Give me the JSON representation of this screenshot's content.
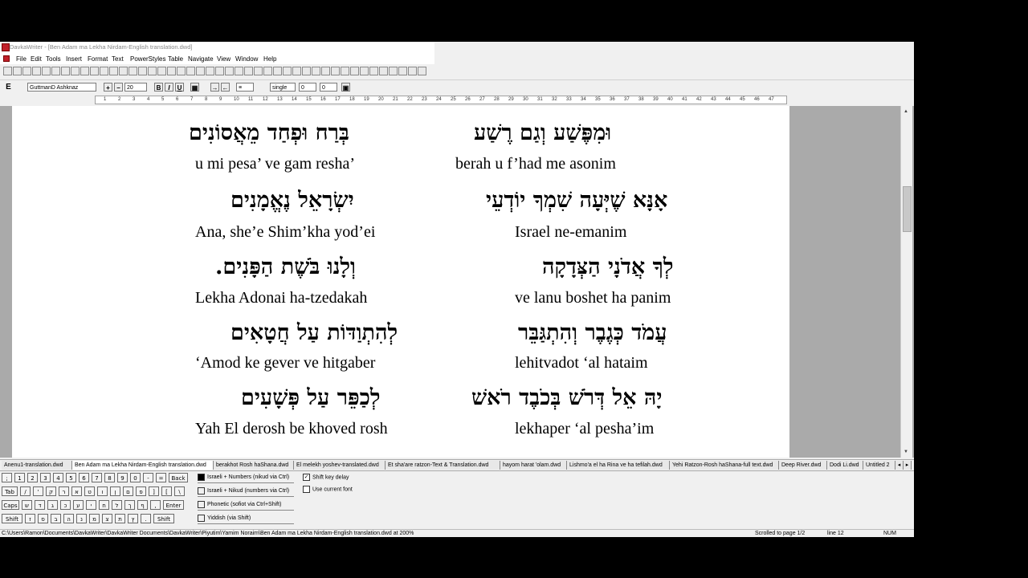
{
  "window": {
    "title": "DavkaWriter - [Ben Adam ma Lekha Nirdam-English translation.dwd]"
  },
  "menu": [
    "File",
    "Edit",
    "Tools",
    "Insert",
    "Format",
    "Text",
    "PowerStyles",
    "Table",
    "Navigate",
    "View",
    "Window",
    "Help"
  ],
  "format_bar": {
    "font": "GuttmanD Ashknaz",
    "size": "20",
    "spacing": "single",
    "value1": "0",
    "value2": "0"
  },
  "ruler_numbers": [
    "1",
    "2",
    "3",
    "4",
    "5",
    "6",
    "7",
    "8",
    "9",
    "10",
    "11",
    "12",
    "13",
    "14",
    "15",
    "16",
    "17",
    "18",
    "19",
    "20",
    "21",
    "22",
    "23",
    "24",
    "25",
    "26",
    "27",
    "28",
    "29",
    "30",
    "31",
    "32",
    "33",
    "34",
    "35",
    "36",
    "37",
    "38",
    "39",
    "40",
    "41",
    "42",
    "43",
    "44",
    "45",
    "46",
    "47"
  ],
  "document": {
    "lines": [
      {
        "heb_right": "וּמִפֶּשַׁע וְגַם רֶשַׁע",
        "heb_left": "בְּרַח וּפְחַד מֵאֲסוֹנִים",
        "eng_left": "u mi pesa’ ve gam resha’",
        "eng_right": "berah u f’had me asonim"
      },
      {
        "heb_right": "אָנָּא שֶׁיְּעָה שִׁמְךָ יוֹדְעֵי",
        "heb_left": "יִשְׂרָאֵל נֶאֱמָנִים",
        "eng_left": "Ana, she’e Shim’kha yod’ei",
        "eng_right": "Israel ne-emanim"
      },
      {
        "heb_right": "לְךָ אֲדֹנָי הַצְּדָקָה",
        "heb_left": "וְלָנוּ בֹּשֶׁת הַפָּנִים.",
        "eng_left": "Lekha Adonai ha-tzedakah",
        "eng_right": "ve lanu boshet ha panim"
      },
      {
        "heb_right": "עֲמֹד כְּגֶבֶר וְהִתְגַּבֵּר",
        "heb_left": "לְהִתְוַדּוֹת עַל חֲטָאִים",
        "eng_left": "‘Amod ke gever ve hitgaber",
        "eng_right": "lehitvadot ‘al hataim"
      },
      {
        "heb_right": "יָהּ אֵל דְּרֹשׁ בְּכֹבֶד רֹאשׁ",
        "heb_left": "לְכַפֵּר עַל פְּשָׁעִים",
        "eng_left": "Yah El derosh be khoved rosh",
        "eng_right": "lekhaper ‘al pesha’im"
      }
    ]
  },
  "tabs": [
    "Anenu1-translation.dwd",
    "Ben Adam ma Lekha Nirdam-English translation.dwd",
    "berakhot Rosh haShana.dwd",
    "El melekh yoshev-translated.dwd",
    "Et sha'are ratzon-Text & Translation.dwd",
    "hayom harat 'olam.dwd",
    "Lishmo'a el ha Rina ve ha tefilah.dwd",
    "Yehi Ratzon-Rosh haShana-full text.dwd",
    "Deep River.dwd",
    "Dodi Li.dwd",
    "Untitled 2"
  ],
  "keyboard": {
    "row1": [
      ";",
      "1",
      "2",
      "3",
      "4",
      "5",
      "6",
      "7",
      "8",
      "9",
      "0",
      "-",
      "=",
      "Back"
    ],
    "row2": [
      "Tab",
      "/",
      "'",
      "ק",
      "ר",
      "א",
      "ט",
      "ו",
      "ן",
      "ם",
      "פ",
      "]",
      "[",
      "\\"
    ],
    "row3": [
      "Caps",
      "ש",
      "ד",
      "ג",
      "כ",
      "ע",
      "י",
      "ח",
      "ל",
      "ך",
      "ף",
      ",",
      "Enter"
    ],
    "row4": [
      "Shift",
      "ז",
      "ס",
      "ב",
      "ה",
      "נ",
      "מ",
      "צ",
      "ת",
      "ץ",
      ".",
      "Shift"
    ]
  },
  "input_modes": [
    "Israeli + Numbers (nikud via Ctrl)",
    "Israeli + Nikud (numbers via Ctrl)",
    "Phonetic (sofiot via Ctrl+Shift)",
    "Yiddish (via Shift)"
  ],
  "options": {
    "shift_key_delay": "Shift key delay",
    "use_current_font": "Use current font"
  },
  "status": {
    "path": "C:\\Users\\Ramon\\Documents\\DavkaWriter\\DavkaWriter Documents\\DavkaWriter\\Piyutim\\Yamim Noraim\\Ben Adam ma Lekha Nirdam-English translation.dwd at 200%",
    "scroll": "Scrolled to page 1/2",
    "line": "line 12",
    "num": "NUM"
  }
}
